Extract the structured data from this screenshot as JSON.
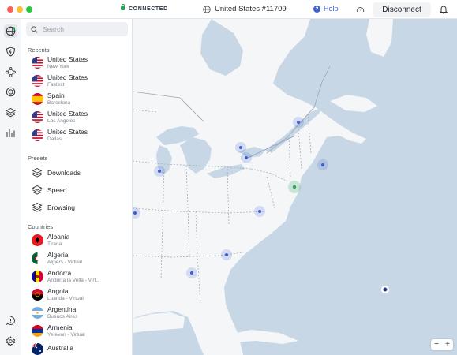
{
  "titlebar": {
    "status": "CONNECTED",
    "server": "United States #11709",
    "help": "Help",
    "disconnect": "Disconnect"
  },
  "rail": {
    "icons": [
      "globe-icon",
      "shield-icon",
      "mesh-network-icon",
      "target-icon",
      "layers-icon",
      "chart-icon",
      "feedback-icon",
      "gear-icon"
    ]
  },
  "sidebar": {
    "search_placeholder": "Search",
    "recents_label": "Recents",
    "recents": [
      {
        "name": "United States",
        "sub": "New York",
        "flag": "us"
      },
      {
        "name": "United States",
        "sub": "Fastest",
        "flag": "us"
      },
      {
        "name": "Spain",
        "sub": "Barcelona",
        "flag": "es"
      },
      {
        "name": "United States",
        "sub": "Los Angeles",
        "flag": "us"
      },
      {
        "name": "United States",
        "sub": "Dallas",
        "flag": "us"
      }
    ],
    "presets_label": "Presets",
    "presets": [
      {
        "name": "Downloads"
      },
      {
        "name": "Speed"
      },
      {
        "name": "Browsing"
      }
    ],
    "countries_label": "Countries",
    "countries": [
      {
        "name": "Albania",
        "sub": "Tirana",
        "flag": "al"
      },
      {
        "name": "Algeria",
        "sub": "Algiers - Virtual",
        "flag": "dz"
      },
      {
        "name": "Andorra",
        "sub": "Andorra la Vella - Virt...",
        "flag": "ad"
      },
      {
        "name": "Angola",
        "sub": "Luanda - Virtual",
        "flag": "ao"
      },
      {
        "name": "Argentina",
        "sub": "Buenos Aires",
        "flag": "ar"
      },
      {
        "name": "Armenia",
        "sub": "Yerevan - Virtual",
        "flag": "am"
      },
      {
        "name": "Australia",
        "sub": "",
        "flag": "au"
      }
    ]
  },
  "map": {
    "zoom_out": "−",
    "zoom_in": "+",
    "colors": {
      "ocean": "#c8d7e5",
      "land": "#f4f6f8",
      "server": "#3e5fd1",
      "connected": "#27a35a"
    }
  }
}
